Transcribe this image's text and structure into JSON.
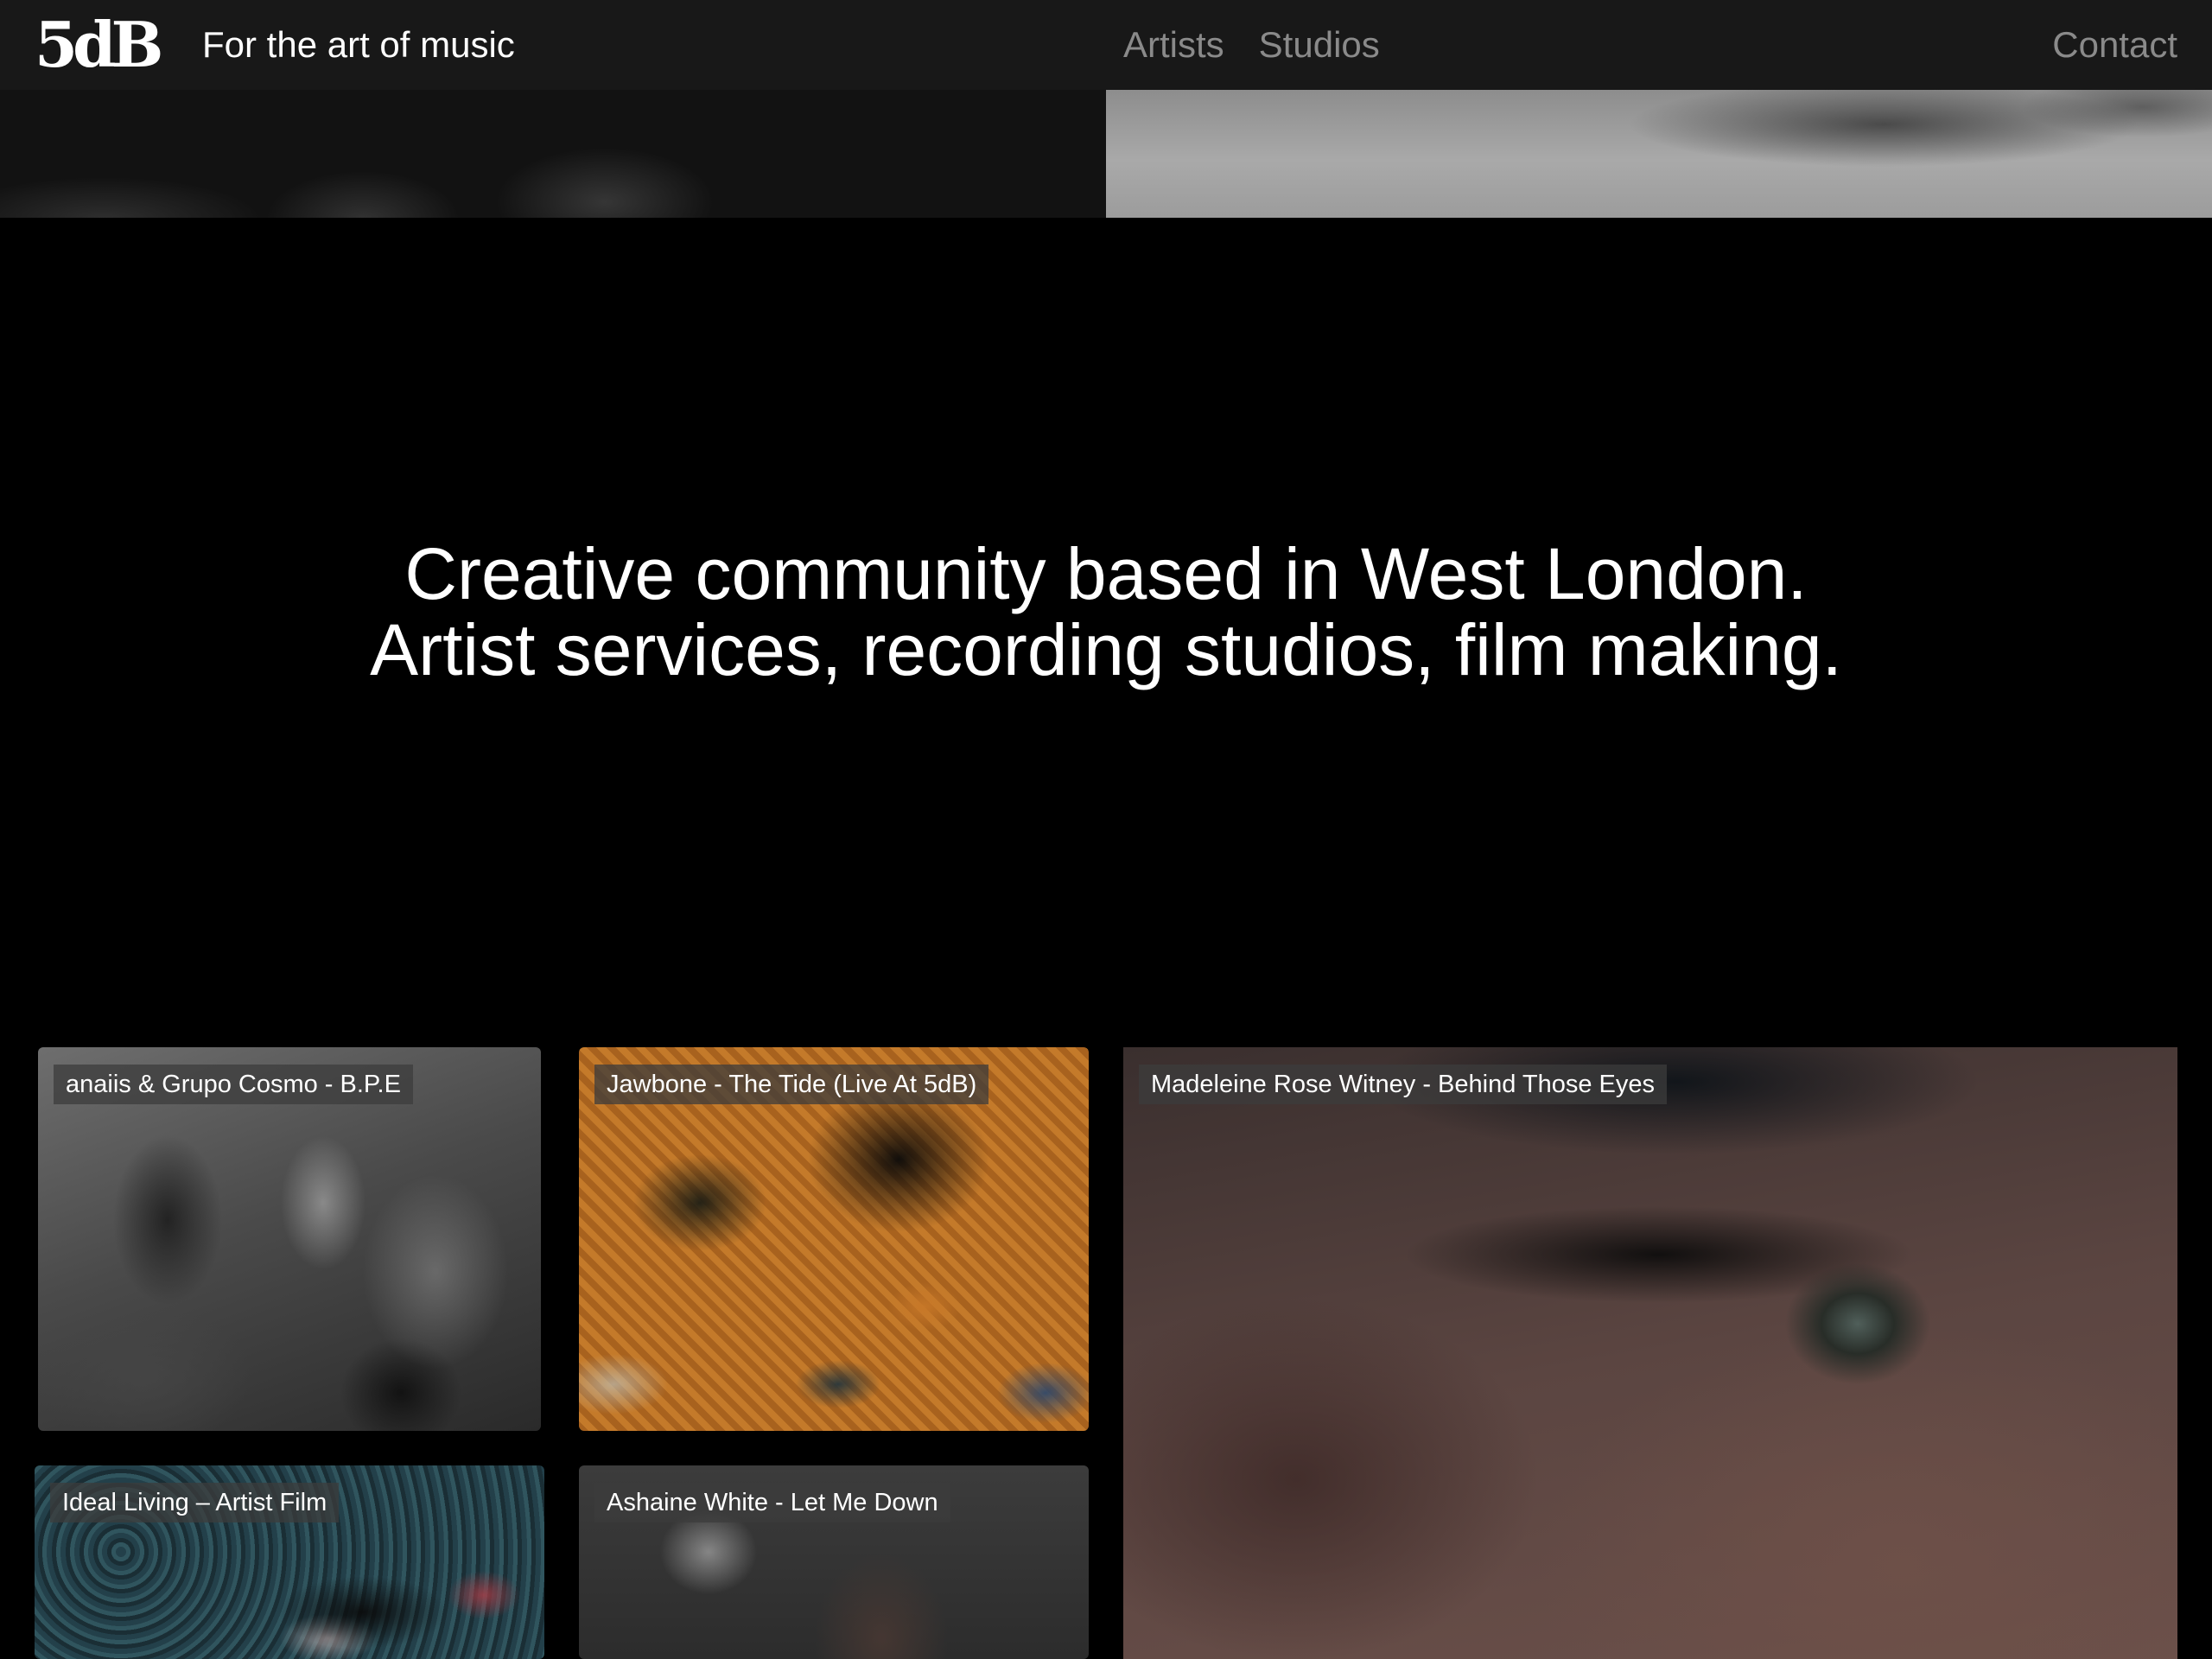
{
  "header": {
    "logo": "5dB",
    "tagline": "For the art of music",
    "nav": [
      "Artists",
      "Studios"
    ],
    "contact": "Contact"
  },
  "hero": {
    "line1": "Creative community based in West London.",
    "line2": "Artist services, recording studios, film making."
  },
  "cards": [
    {
      "title": "anaiis & Grupo Cosmo - B.P.E"
    },
    {
      "title": "Jawbone - The Tide (Live At 5dB)"
    },
    {
      "title": "Madeleine Rose Witney - Behind Those Eyes"
    },
    {
      "title": "Ideal Living – Artist Film"
    },
    {
      "title": "Ashaine White - Let Me Down"
    }
  ],
  "colors": {
    "header_bg": "#181818",
    "page_bg": "#000000",
    "nav_text": "#8a8a8a",
    "text": "#ffffff"
  }
}
